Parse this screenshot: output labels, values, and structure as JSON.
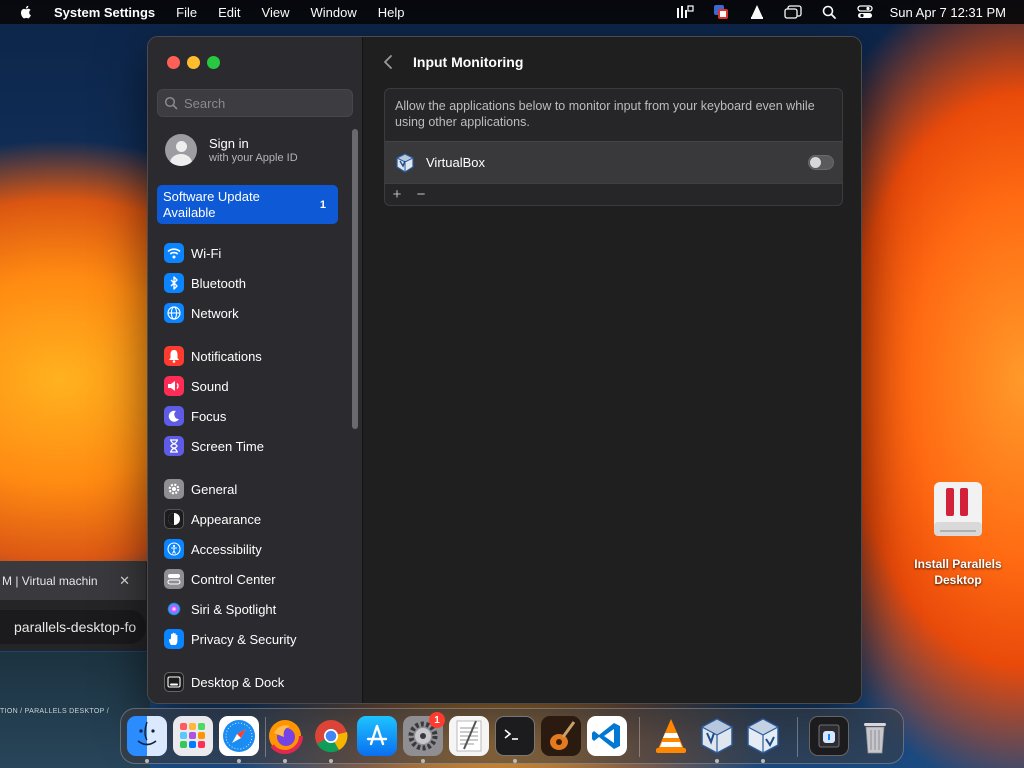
{
  "menubar": {
    "app": "System Settings",
    "items": [
      "File",
      "Edit",
      "View",
      "Window",
      "Help"
    ],
    "clock": "Sun Apr 7  12:31 PM"
  },
  "browser_background": {
    "tab_title": "M | Virtual machin",
    "tab_close": "✕",
    "url_text": "parallels-desktop-fo",
    "breadcrumb": "TION   /   PARALLELS DESKTOP   /"
  },
  "desktop": {
    "item_label_line1": "Install Parallels",
    "item_label_line2": "Desktop"
  },
  "sidebar": {
    "search_placeholder": "Search",
    "signin_title": "Sign in",
    "signin_sub": "with your Apple ID",
    "update_label": "Software Update Available",
    "update_badge": "1",
    "items": [
      {
        "label": "Wi-Fi",
        "icon": "wifi-icon",
        "color": "#0a84ff"
      },
      {
        "label": "Bluetooth",
        "icon": "bluetooth-icon",
        "color": "#0a84ff"
      },
      {
        "label": "Network",
        "icon": "globe-icon",
        "color": "#0a84ff"
      },
      {
        "label": "Notifications",
        "icon": "bell-icon",
        "color": "#ff3b30"
      },
      {
        "label": "Sound",
        "icon": "speaker-icon",
        "color": "#ff2d55"
      },
      {
        "label": "Focus",
        "icon": "moon-icon",
        "color": "#5e5ce6"
      },
      {
        "label": "Screen Time",
        "icon": "hourglass-icon",
        "color": "#5e5ce6"
      },
      {
        "label": "General",
        "icon": "gear-icon",
        "color": "#8e8e93"
      },
      {
        "label": "Appearance",
        "icon": "appearance-icon",
        "color": "#1c1c1e"
      },
      {
        "label": "Accessibility",
        "icon": "accessibility-icon",
        "color": "#0a84ff"
      },
      {
        "label": "Control Center",
        "icon": "control-center-icon",
        "color": "#8e8e93"
      },
      {
        "label": "Siri & Spotlight",
        "icon": "siri-icon",
        "color": "#2c2c2e"
      },
      {
        "label": "Privacy & Security",
        "icon": "hand-icon",
        "color": "#0a84ff"
      },
      {
        "label": "Desktop & Dock",
        "icon": "dock-icon",
        "color": "#1c1c1e"
      }
    ]
  },
  "main": {
    "title": "Input Monitoring",
    "description": "Allow the applications below to monitor input from your keyboard even while using other applications.",
    "apps": [
      {
        "name": "VirtualBox",
        "enabled": false
      }
    ],
    "add_label": "+",
    "remove_label": "−"
  },
  "dock": {
    "apps": [
      "Finder",
      "Launchpad",
      "Safari",
      "Firefox",
      "Chrome",
      "App Store",
      "System Settings",
      "TextEdit",
      "Terminal",
      "GarageBand",
      "Visual Studio Code",
      "VLC",
      "VirtualBox",
      "VirtualBox VM",
      "Downloads",
      "Trash"
    ],
    "settings_badge": "1"
  },
  "colors": {
    "accent": "#0d59d6",
    "sidebar_bg": "#2b2a2e",
    "main_bg": "#1f1f1f"
  }
}
